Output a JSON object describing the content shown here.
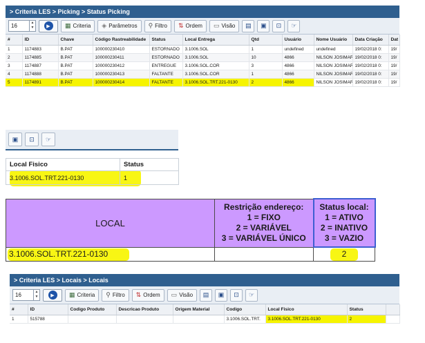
{
  "panel1": {
    "breadcrumb": "> Criteria LES > Picking > Status Picking",
    "toolbar": {
      "page_size": "16",
      "criteria": "Criteria",
      "params": "Parâmetros",
      "filter": "Filtro",
      "order": "Ordem",
      "view": "Visão"
    },
    "columns": [
      "#",
      "ID",
      "Chave",
      "Código Rastreabilidade",
      "Status",
      "Local Entrega",
      "Qtd",
      "Usuário",
      "Nome Usuário",
      "Data Criação",
      "Dat"
    ],
    "rows": [
      [
        "1",
        "1174883",
        "B.PAT",
        "100000230410",
        "ESTORNADO",
        "3.1006.SOL",
        "1",
        "undefined",
        "undefined",
        "19/02/2018 0:",
        "19/"
      ],
      [
        "2",
        "1174885",
        "B.PAT",
        "100000230411",
        "ESTORNADO",
        "3.1006.SOL",
        "10",
        "4866",
        "NILSON JOSIMAR",
        "19/02/2018 0:",
        "19/"
      ],
      [
        "3",
        "1174887",
        "B.PAT",
        "100000230412",
        "ENTREGUE",
        "3.1006.SOL.COR",
        "3",
        "4866",
        "NILSON JOSIMAR",
        "19/02/2018 0:",
        "19/"
      ],
      [
        "4",
        "1174888",
        "B.PAT",
        "100000230413",
        "FALTANTE",
        "3.1006.SOL.COR",
        "1",
        "4866",
        "NILSON JOSIMAR",
        "19/02/2018 0:",
        "19/"
      ],
      [
        "5",
        "1174891",
        "B.PAT",
        "100000230414",
        "FALTANTE",
        "3.1006.SOL.TRT.221-0130",
        "2",
        "4866",
        "NILSON JOSIMAR",
        "19/02/2018 0:",
        "19/"
      ]
    ]
  },
  "panel2": {
    "headers": [
      "Local Fisico",
      "Status"
    ],
    "row": [
      "3.1006.SOL.TRT.221-0130",
      "1"
    ]
  },
  "panel3": {
    "local_header": "LOCAL",
    "restricao_lines": [
      "Restrição endereço:",
      "1 = FIXO",
      "2 = VARIÁVEL",
      "3 = VARIÁVEL ÚNICO"
    ],
    "status_lines": [
      "Status local:",
      "1 = ATIVO",
      "2 = INATIVO",
      "3 = VAZIO"
    ],
    "local_value": "3.1006.SOL.TRT.221-0130",
    "status_value": "2",
    "header_color": "#cc99ff"
  },
  "panel4": {
    "breadcrumb": "> Criteria LES > Locais > Locais",
    "toolbar": {
      "page_size": "16",
      "criteria": "Criteria",
      "filter": "Filtro",
      "order": "Ordem",
      "view": "Visão"
    },
    "columns": [
      "#",
      "ID",
      "Codigo Produto",
      "Descricao Produto",
      "Origem Material",
      "Codigo",
      "Local Fisico",
      "Status"
    ],
    "row": [
      "1",
      "515788",
      "",
      "",
      "",
      "3.1006.SOL.TRT.",
      "3.1006.SOL.TRT.221-0130",
      "2"
    ]
  },
  "colors": {
    "header_blue": "#2f5f8f",
    "highlight": "#f6f400"
  }
}
